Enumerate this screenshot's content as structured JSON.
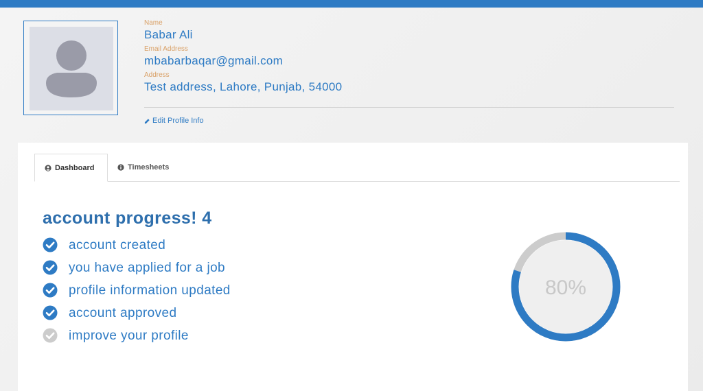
{
  "colors": {
    "accent": "#2e7bc4",
    "label": "#d9a066",
    "ring_track": "#cccccc",
    "check_done": "#2e7bc4",
    "check_pending": "#cccccc"
  },
  "profile": {
    "avatar_icon": "user-placeholder-icon",
    "name_label": "Name",
    "name": "Babar Ali",
    "email_label": "Email Address",
    "email": "mbabarbaqar@gmail.com",
    "address_label": "Address",
    "address": "Test address, Lahore, Punjab, 54000",
    "edit_label": "Edit Profile Info",
    "edit_icon": "pencil-icon"
  },
  "tabs": [
    {
      "label": "Dashboard",
      "icon": "user-circle-icon",
      "active": true
    },
    {
      "label": "Timesheets",
      "icon": "info-circle-icon",
      "active": false
    }
  ],
  "dashboard": {
    "progress_title": "account progress! 4",
    "checklist": [
      {
        "text": "account created",
        "done": true
      },
      {
        "text": "you have applied for a job",
        "done": true
      },
      {
        "text": "profile information updated",
        "done": true
      },
      {
        "text": "account approved",
        "done": true
      },
      {
        "text": "improve your profile",
        "done": false
      }
    ],
    "progress_percent": 80,
    "progress_label": "80%"
  }
}
